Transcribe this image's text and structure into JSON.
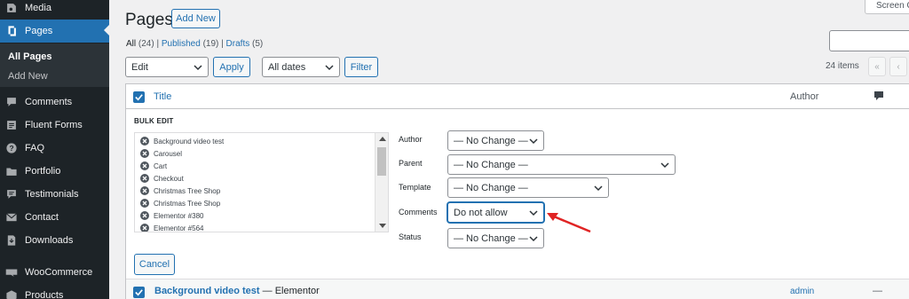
{
  "sidebar": {
    "items": [
      {
        "label": "Media",
        "icon": "media-icon"
      },
      {
        "label": "Pages",
        "icon": "pages-icon",
        "active": true
      },
      {
        "label": "Comments",
        "icon": "comments-icon"
      },
      {
        "label": "Fluent Forms",
        "icon": "forms-icon"
      },
      {
        "label": "FAQ",
        "icon": "faq-icon"
      },
      {
        "label": "Portfolio",
        "icon": "portfolio-icon"
      },
      {
        "label": "Testimonials",
        "icon": "testimonials-icon"
      },
      {
        "label": "Contact",
        "icon": "contact-icon"
      },
      {
        "label": "Downloads",
        "icon": "downloads-icon"
      },
      {
        "label": "WooCommerce",
        "icon": "woocommerce-icon"
      },
      {
        "label": "Products",
        "icon": "products-icon"
      }
    ],
    "submenu": [
      "All Pages",
      "Add New"
    ]
  },
  "header": {
    "title": "Pages",
    "add_new": "Add New",
    "screen_options": "Screen O"
  },
  "filters": {
    "all_label": "All",
    "all_count": "(24)",
    "published_label": "Published",
    "published_count": "(19)",
    "drafts_label": "Drafts",
    "drafts_count": "(5)",
    "sep": "|"
  },
  "toolbar": {
    "bulk_action": "Edit",
    "apply": "Apply",
    "dates": "All dates",
    "filter": "Filter",
    "items_count": "24 items",
    "first_page": "«",
    "prev_page": "‹"
  },
  "table": {
    "col_title": "Title",
    "col_author": "Author"
  },
  "bulk_edit": {
    "heading": "BULK EDIT",
    "selected_pages": [
      "Background video test",
      "Carousel",
      "Cart",
      "Checkout",
      "Christmas Tree Shop",
      "Christmas Tree Shop",
      "Elementor #380",
      "Elementor #564"
    ],
    "fields": {
      "author_label": "Author",
      "author_value": "— No Change —",
      "parent_label": "Parent",
      "parent_value": "— No Change —",
      "template_label": "Template",
      "template_value": "— No Change —",
      "comments_label": "Comments",
      "comments_value": "Do not allow",
      "status_label": "Status",
      "status_value": "— No Change —"
    },
    "cancel": "Cancel"
  },
  "row": {
    "title": "Background video test",
    "suffix": " — Elementor",
    "author": "admin",
    "comments": "—"
  },
  "colors": {
    "accent": "#2271b1",
    "sidebar_bg": "#1d2327",
    "arrow": "#e02424"
  }
}
